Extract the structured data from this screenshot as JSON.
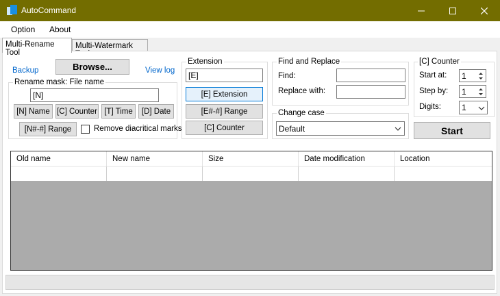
{
  "window": {
    "title": "AutoCommand",
    "accent": "#736d00"
  },
  "menu": [
    "Option",
    "About"
  ],
  "tabs": [
    "Multi-Rename Tool",
    "Multi-Watermark Tool"
  ],
  "left": {
    "backup": "Backup",
    "browse": "Browse...",
    "viewlog": "View log",
    "mask_title": "Rename mask: File name",
    "mask_value": "[N]",
    "btn_name": "[N] Name",
    "btn_counter": "[C] Counter",
    "btn_time": "[T] Time",
    "btn_date": "[D] Date",
    "btn_range": "[N#-#] Range",
    "remove_diacritics": "Remove diacritical marks"
  },
  "extension": {
    "title": "Extension",
    "value": "[E]",
    "btn_ext": "[E] Extension",
    "btn_range": "[E#-#] Range",
    "btn_counter": "[C] Counter"
  },
  "find_replace": {
    "title": "Find and Replace",
    "find_label": "Find:",
    "find_value": "",
    "replace_label": "Replace with:",
    "replace_value": ""
  },
  "change_case": {
    "title": "Change case",
    "value": "Default"
  },
  "counter": {
    "title": "[C] Counter",
    "start_label": "Start at:",
    "start_value": "1",
    "step_label": "Step by:",
    "step_value": "1",
    "digits_label": "Digits:",
    "digits_value": "1"
  },
  "start_button": "Start",
  "grid": {
    "columns": [
      "Old name",
      "New name",
      "Size",
      "Date modification",
      "Location"
    ]
  },
  "status": ""
}
